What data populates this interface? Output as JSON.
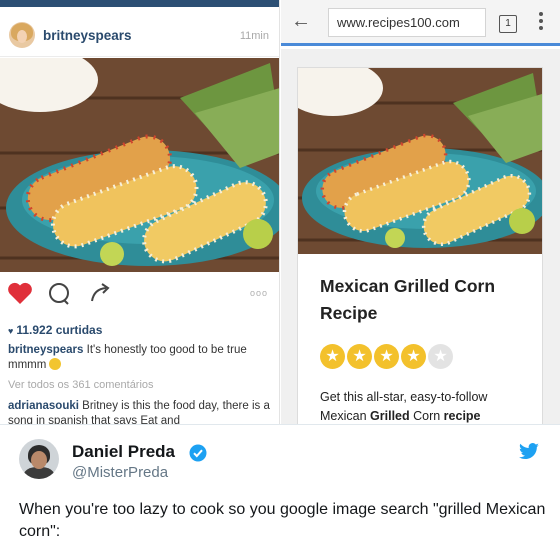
{
  "instagram": {
    "username": "britneyspears",
    "time": "11min",
    "more": "ooo",
    "likes": "11.922 curtidas",
    "caption": {
      "user": "britneyspears",
      "text": " It's honestly too good to be true mmmm"
    },
    "view_all": "Ver todos os 361 comentários",
    "comment": {
      "user": "adrianasouki",
      "text": " Britney is this the food day, there is a song in spanish that says Eat and"
    }
  },
  "browser": {
    "url": "www.recipes100.com",
    "tab_count": "1",
    "recipe_title": "Mexican Grilled Corn Recipe",
    "rating": {
      "value": 4,
      "max": 5
    },
    "description": {
      "line1": "Get this all-star, easy-to-follow",
      "pre": "Mexican ",
      "bold1": "Grilled",
      "mid": " Corn ",
      "bold2": "recipe"
    }
  },
  "tweet": {
    "name": "Daniel Preda",
    "handle": "@MisterPreda",
    "text": "When you're too lazy to cook so you google image search \"grilled Mexican corn\":"
  },
  "colors": {
    "instagram_blue": "#2a4a6d",
    "heart_red": "#e0303a",
    "star_yellow": "#f3c12c",
    "twitter_blue": "#1da1f2"
  }
}
